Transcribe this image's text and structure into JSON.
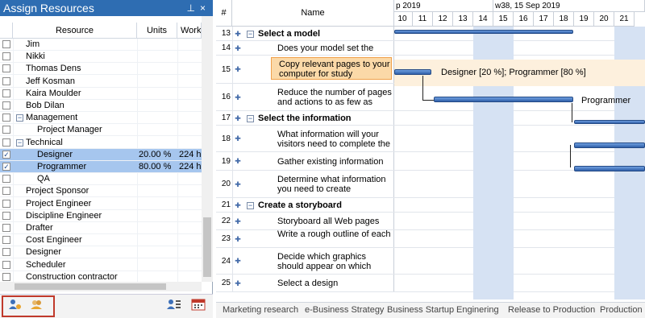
{
  "panel": {
    "title": "Assign Resources",
    "pin_glyph": "📌",
    "close_glyph": "×",
    "columns": [
      "Resource",
      "Units",
      "Work"
    ],
    "rows": [
      {
        "name": "Jim",
        "units": "",
        "work": "",
        "checked": false,
        "level": 0
      },
      {
        "name": "Nikki",
        "units": "",
        "work": "",
        "checked": false,
        "level": 0
      },
      {
        "name": "Thomas Dens",
        "units": "",
        "work": "",
        "checked": false,
        "level": 0
      },
      {
        "name": "Jeff Kosman",
        "units": "",
        "work": "",
        "checked": false,
        "level": 0
      },
      {
        "name": "Kaira Moulder",
        "units": "",
        "work": "",
        "checked": false,
        "level": 0
      },
      {
        "name": "Bob Dilan",
        "units": "",
        "work": "",
        "checked": false,
        "level": 0
      },
      {
        "name": "Management",
        "units": "",
        "work": "",
        "checked": false,
        "level": 0,
        "group": true
      },
      {
        "name": "Project Manager",
        "units": "",
        "work": "",
        "checked": false,
        "level": 1
      },
      {
        "name": "Technical",
        "units": "",
        "work": "",
        "checked": false,
        "level": 0,
        "group": true
      },
      {
        "name": "Designer",
        "units": "20.00 %",
        "work": "224 h",
        "checked": true,
        "level": 1,
        "selected": true
      },
      {
        "name": "Programmer",
        "units": "80.00 %",
        "work": "224 h",
        "checked": true,
        "level": 1,
        "selected": true
      },
      {
        "name": "QA",
        "units": "",
        "work": "",
        "checked": false,
        "level": 1
      },
      {
        "name": "Project Sponsor",
        "units": "",
        "work": "",
        "checked": false,
        "level": 0
      },
      {
        "name": "Project Engineer",
        "units": "",
        "work": "",
        "checked": false,
        "level": 0
      },
      {
        "name": "Discipline Engineer",
        "units": "",
        "work": "",
        "checked": false,
        "level": 0
      },
      {
        "name": "Drafter",
        "units": "",
        "work": "",
        "checked": false,
        "level": 0
      },
      {
        "name": "Cost Engineer",
        "units": "",
        "work": "",
        "checked": false,
        "level": 0
      },
      {
        "name": "Designer",
        "units": "",
        "work": "",
        "checked": false,
        "level": 0
      },
      {
        "name": "Scheduler",
        "units": "",
        "work": "",
        "checked": false,
        "level": 0
      },
      {
        "name": "Construction contractor",
        "units": "",
        "work": "",
        "checked": false,
        "level": 0
      }
    ]
  },
  "grid": {
    "col_num": "#",
    "col_name": "Name",
    "weeks": [
      "p 2019",
      "w38, 15 Sep 2019"
    ],
    "days": [
      "10",
      "11",
      "12",
      "13",
      "14",
      "15",
      "16",
      "17",
      "18",
      "19",
      "20",
      "21"
    ],
    "tasks": [
      {
        "num": "13",
        "name": "Select a model",
        "summary": true
      },
      {
        "num": "14",
        "name": "Does your model set the"
      },
      {
        "num": "15",
        "name": "Copy relevant pages to your computer for study",
        "highlight": true
      },
      {
        "num": "16",
        "name": "Reduce the number of pages and actions to as few as"
      },
      {
        "num": "17",
        "name": "Select the information",
        "summary": true
      },
      {
        "num": "18",
        "name": "What information will your visitors need to complete the"
      },
      {
        "num": "19",
        "name": "Gather existing information"
      },
      {
        "num": "20",
        "name": "Determine what information you need to create"
      },
      {
        "num": "21",
        "name": "Create a storyboard",
        "summary": true
      },
      {
        "num": "22",
        "name": "Storyboard all Web pages"
      },
      {
        "num": "23",
        "name": "Write a rough outline of each"
      },
      {
        "num": "24",
        "name": "Decide which graphics should appear on which"
      },
      {
        "num": "25",
        "name": "Select a design"
      }
    ],
    "resource_labels": {
      "row15": "Designer  [20 %]; Programmer [80 %]",
      "row16": "Programmer"
    }
  },
  "tabs": [
    "Marketing research",
    "e-Business Strategy",
    "Business Startup",
    "Enginering",
    "Release to Production",
    "Production"
  ]
}
